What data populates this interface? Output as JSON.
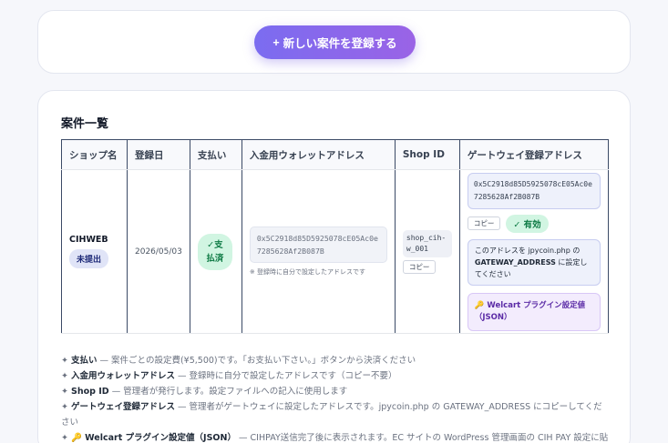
{
  "register_button": {
    "icon": "+",
    "label": "新しい案件を登録する"
  },
  "section_title": "案件一覧",
  "table": {
    "headers": [
      "ショップ名",
      "登録日",
      "支払い",
      "入金用ウォレットアドレス",
      "Shop ID",
      "ゲートウェイ登録アドレス"
    ],
    "row": {
      "shop_name": "CIHWEB",
      "status_badge": "未提出",
      "date": "2026/05/03",
      "payment_badge": "✓支払済",
      "wallet_address": "0x5C2918d85D5925078cE05Ac0e7285628Af2B087B",
      "wallet_note": "※ 登録時に自分で設定したアドレスです",
      "shop_id": "shop_cih-w_001",
      "shop_id_copy": "コピー",
      "gateway_address": "0x5C2918d85D5925078cE05Ac0e7285628Af2B087B",
      "gateway_copy": "コピー",
      "gateway_active": "✓ 有効",
      "gateway_note_pre": "このアドレスを jpycoin.php の ",
      "gateway_note_key": "GATEWAY_ADDRESS",
      "gateway_note_post": " に設定してください",
      "welcart_button": "🔑 Welcart プラグイン設定値（JSON）"
    }
  },
  "legend": [
    {
      "mark": "✦",
      "term": "支払い",
      "desc": " — 案件ごとの設定費(¥5,500)です。「お支払い下さい。」ボタンから決済ください"
    },
    {
      "mark": "✦",
      "term": "入金用ウォレットアドレス",
      "desc": " — 登録時に自分で設定したアドレスです（コピー不要）"
    },
    {
      "mark": "✦",
      "term": "Shop ID",
      "desc": " — 管理者が発行します。設定ファイルへの記入に使用します"
    },
    {
      "mark": "✦",
      "term": "ゲートウェイ登録アドレス",
      "desc": " — 管理者がゲートウェイに設定したアドレスです。jpycoin.php の GATEWAY_ADDRESS にコピーしてください"
    },
    {
      "mark": "✦",
      "term": "🔑 Welcart プラグイン設定値（JSON）",
      "desc": " — CIHPAY送信完了後に表示されます。EC サイトの WordPress 管理画面の CIH PAY 設定に貼"
    }
  ],
  "colors": {
    "accent": "#7b6cf0",
    "paid": "#0d7a44",
    "paid_bg": "#d1f5e2"
  }
}
